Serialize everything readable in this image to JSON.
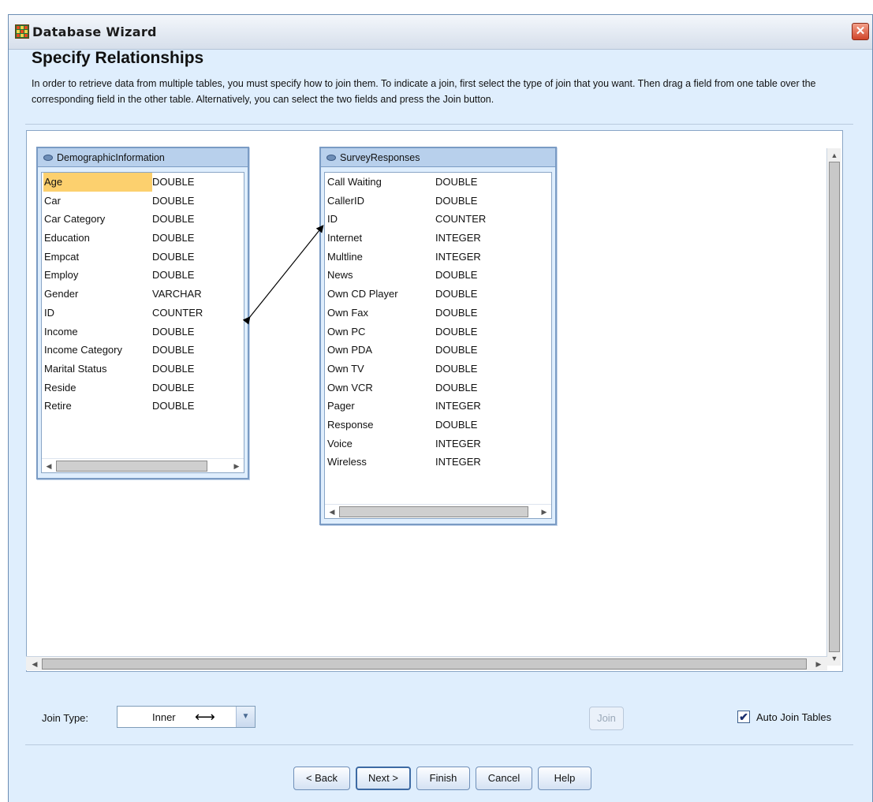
{
  "window": {
    "title": "Database Wizard",
    "close_glyph": "✕"
  },
  "page": {
    "heading": "Specify Relationships",
    "description": "In order to retrieve data from multiple tables, you must specify how to join them. To indicate a join, first select the type of join that you want. Then drag a field from one table over the corresponding field in the other table. Alternatively, you can select the two fields and press the Join button."
  },
  "tables": [
    {
      "name": "DemographicInformation",
      "fields": [
        {
          "name": "Age",
          "type": "DOUBLE",
          "selected": true
        },
        {
          "name": "Car",
          "type": "DOUBLE"
        },
        {
          "name": "Car Category",
          "type": "DOUBLE"
        },
        {
          "name": "Education",
          "type": "DOUBLE"
        },
        {
          "name": "Empcat",
          "type": "DOUBLE"
        },
        {
          "name": "Employ",
          "type": "DOUBLE"
        },
        {
          "name": "Gender",
          "type": "VARCHAR"
        },
        {
          "name": "ID",
          "type": "COUNTER"
        },
        {
          "name": "Income",
          "type": "DOUBLE"
        },
        {
          "name": "Income Category",
          "type": "DOUBLE"
        },
        {
          "name": "Marital Status",
          "type": "DOUBLE"
        },
        {
          "name": "Reside",
          "type": "DOUBLE"
        },
        {
          "name": "Retire",
          "type": "DOUBLE"
        }
      ]
    },
    {
      "name": "SurveyResponses",
      "fields": [
        {
          "name": "Call Waiting",
          "type": "DOUBLE"
        },
        {
          "name": "CallerID",
          "type": "DOUBLE"
        },
        {
          "name": "ID",
          "type": "COUNTER"
        },
        {
          "name": "Internet",
          "type": "INTEGER"
        },
        {
          "name": "Multline",
          "type": "INTEGER"
        },
        {
          "name": "News",
          "type": "DOUBLE"
        },
        {
          "name": "Own CD Player",
          "type": "DOUBLE"
        },
        {
          "name": "Own Fax",
          "type": "DOUBLE"
        },
        {
          "name": "Own PC",
          "type": "DOUBLE"
        },
        {
          "name": "Own PDA",
          "type": "DOUBLE"
        },
        {
          "name": "Own TV",
          "type": "DOUBLE"
        },
        {
          "name": "Own VCR",
          "type": "DOUBLE"
        },
        {
          "name": "Pager",
          "type": "INTEGER"
        },
        {
          "name": "Response",
          "type": "DOUBLE"
        },
        {
          "name": "Voice",
          "type": "INTEGER"
        },
        {
          "name": "Wireless",
          "type": "INTEGER"
        }
      ]
    }
  ],
  "join": {
    "from_table": "DemographicInformation",
    "from_field": "ID",
    "to_table": "SurveyResponses",
    "to_field": "ID"
  },
  "controls": {
    "join_type_label": "Join Type:",
    "join_type_value": "Inner",
    "join_type_glyph": "⟷",
    "join_button": "Join",
    "auto_join_label": "Auto Join Tables",
    "auto_join_checked": true,
    "checkmark": "✔"
  },
  "buttons": {
    "back": "< Back",
    "next": "Next >",
    "finish": "Finish",
    "cancel": "Cancel",
    "help": "Help"
  },
  "scroll": {
    "up": "▲",
    "down": "▼",
    "left": "◀",
    "right": "▶",
    "dropdown": "▼"
  },
  "colors": {
    "window_bg": "#dfeefd",
    "table_header": "#b8d0ec",
    "selection": "#fcd06e"
  }
}
